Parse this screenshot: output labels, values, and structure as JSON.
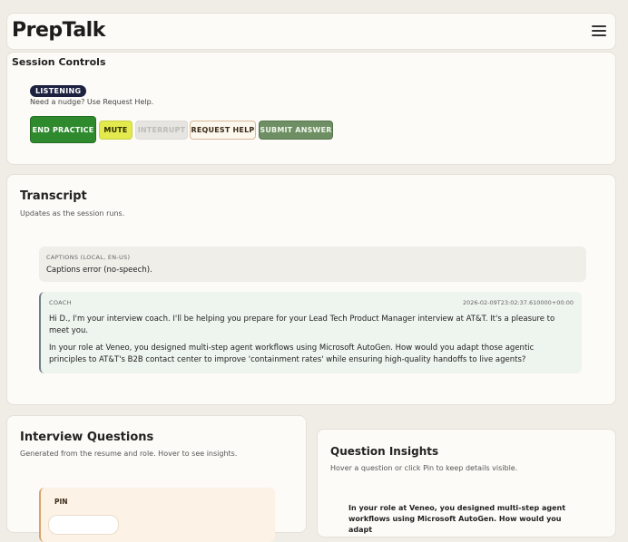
{
  "header": {
    "brand": "PrepTalk",
    "menu_icon": "hamburger-menu-icon"
  },
  "session": {
    "title": "Session Controls",
    "status": "LISTENING",
    "nudge": "Need a nudge? Use Request Help.",
    "buttons": {
      "end": "END PRACTICE",
      "mute": "MUTE",
      "interrupt": "INTERRUPT",
      "help": "REQUEST HELP",
      "submit": "SUBMIT ANSWER"
    }
  },
  "transcript": {
    "title": "Transcript",
    "subtitle": "Updates as the session runs.",
    "captions": {
      "label": "CAPTIONS (LOCAL, EN-US)",
      "text": "Captions error (no-speech)."
    },
    "coach": {
      "label": "COACH",
      "timestamp": "2026-02-09T23:02:37.610000+00:00",
      "p1": "Hi D., I'm your interview coach. I'll be helping you prepare for your Lead Tech Product Manager interview at AT&T. It's a pleasure to meet you.",
      "p2": "In your role at Veneo, you designed multi-step agent workflows using Microsoft AutoGen. How would you adapt those agentic principles to AT&T's B2B contact center to improve 'containment rates' while ensuring high-quality handoffs to live agents?"
    }
  },
  "questions": {
    "title": "Interview Questions",
    "subtitle": "Generated from the resume and role. Hover to see insights.",
    "pin_label": "PIN"
  },
  "insights": {
    "title": "Question Insights",
    "subtitle": "Hover a question or click Pin to keep details visible.",
    "question": "In your role at Veneo, you designed multi-step agent workflows using Microsoft AutoGen. How would you adapt"
  },
  "colors": {
    "page_bg": "#efede6",
    "card_bg": "#fcfbf7",
    "end_button": "#2f8a2e",
    "mute_button": "#e3ea4d",
    "submit_button": "#6d8f63",
    "status_badge": "#1d2140"
  }
}
